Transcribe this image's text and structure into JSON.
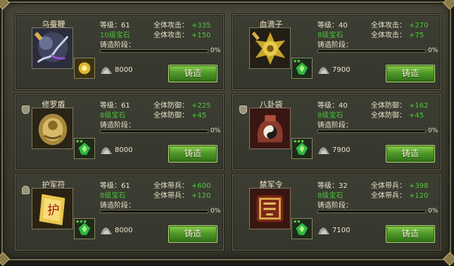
{
  "labels": {
    "level": "等级：",
    "stage": "铸造阶段："
  },
  "cards": [
    {
      "name": "乌蚕鞭",
      "level": "61",
      "stat1_label": "全体攻击：",
      "stat1_value": "+335",
      "stat2_label": "全体攻击：",
      "stat2_value": "+150",
      "gem_text": "10级宝石",
      "progress_text": "0%",
      "progress": 0,
      "cost": "8000",
      "button": "铸造",
      "item_icon": "whip-icon",
      "gem_icon": "gold-gem-icon",
      "gem_stars": "",
      "quality_icon": ""
    },
    {
      "name": "血滴子",
      "level": "40",
      "stat1_label": "全体攻击：",
      "stat1_value": "+270",
      "stat2_label": "全体攻击：",
      "stat2_value": "+75",
      "gem_text": "8级宝石",
      "progress_text": "0%",
      "progress": 0,
      "cost": "7900",
      "button": "铸造",
      "item_icon": "blood-drop-weapon-icon",
      "gem_icon": "green-gem-icon",
      "gem_stars": "★★",
      "quality_icon": ""
    },
    {
      "name": "修罗盾",
      "level": "61",
      "stat1_label": "全体防御：",
      "stat1_value": "+225",
      "stat2_label": "全体防御：",
      "stat2_value": "+45",
      "gem_text": "8级宝石",
      "progress_text": "0%",
      "progress": 0,
      "cost": "8000",
      "button": "铸造",
      "item_icon": "shield-icon",
      "gem_icon": "green-gem-icon",
      "gem_stars": "★★",
      "quality_icon": "shield-quality-icon"
    },
    {
      "name": "八卦袋",
      "level": "40",
      "stat1_label": "全体防御：",
      "stat1_value": "+162",
      "stat2_label": "全体防御：",
      "stat2_value": "+45",
      "gem_text": "8级宝石",
      "progress_text": "0%",
      "progress": 0,
      "cost": "7900",
      "button": "铸造",
      "item_icon": "bagua-bag-icon",
      "gem_icon": "green-gem-icon",
      "gem_stars": "★★★",
      "quality_icon": "shield-quality-icon"
    },
    {
      "name": "护军符",
      "level": "61",
      "stat1_label": "全体带兵：",
      "stat1_value": "+600",
      "stat2_label": "全体带兵：",
      "stat2_value": "+120",
      "gem_text": "8级宝石",
      "progress_text": "0%",
      "progress": 0,
      "cost": "8000",
      "button": "铸造",
      "item_icon": "talisman-icon",
      "gem_icon": "green-gem-icon",
      "gem_stars": "★★★",
      "quality_icon": "helmet-quality-icon"
    },
    {
      "name": "禁军令",
      "level": "32",
      "stat1_label": "全体带兵：",
      "stat1_value": "+398",
      "stat2_label": "全体带兵：",
      "stat2_value": "+120",
      "gem_text": "8级宝石",
      "progress_text": "0%",
      "progress": 0,
      "cost": "7100",
      "button": "铸造",
      "item_icon": "command-token-icon",
      "gem_icon": "green-gem-icon",
      "gem_stars": "★★",
      "quality_icon": ""
    }
  ]
}
